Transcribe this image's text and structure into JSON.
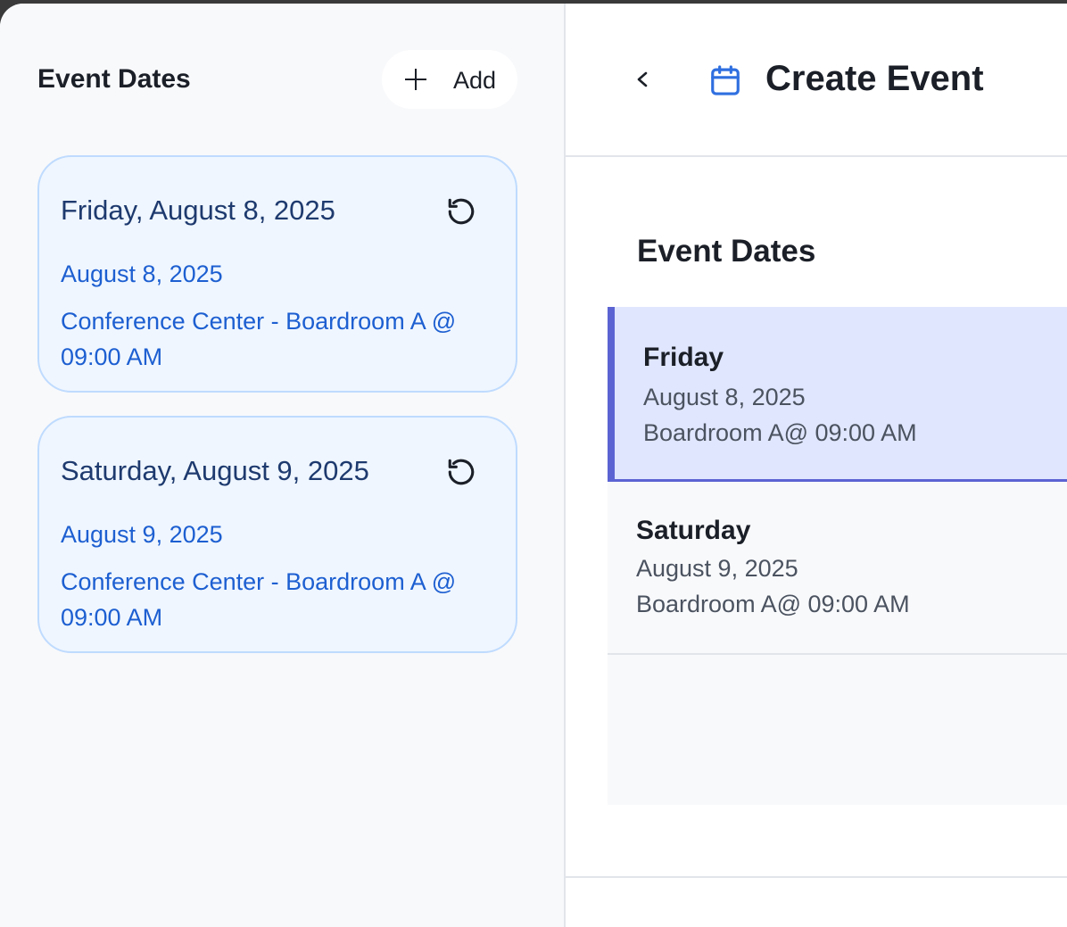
{
  "sidebar": {
    "title": "Event Dates",
    "add_label": "Add",
    "cards": [
      {
        "title": "Friday, August 8, 2025",
        "date": "August 8, 2025",
        "venue": "Conference Center - Boardroom A @ 09:00 AM"
      },
      {
        "title": "Saturday, August 9, 2025",
        "date": "August 9, 2025",
        "venue": "Conference Center - Boardroom A @ 09:00 AM"
      }
    ]
  },
  "header": {
    "title": "Create Event"
  },
  "main": {
    "section_title": "Event Dates",
    "items": [
      {
        "day": "Friday",
        "date": "August 8, 2025",
        "venue": "Boardroom A@ 09:00 AM",
        "selected": true
      },
      {
        "day": "Saturday",
        "date": "August 9, 2025",
        "venue": "Boardroom A@ 09:00 AM",
        "selected": false
      }
    ]
  },
  "colors": {
    "accent": "#5b63d3",
    "card_text": "#1d5fd1",
    "calendar_icon": "#2f6fe0"
  },
  "icons": {
    "add": "plus-icon",
    "reset": "reset-icon",
    "back": "chevron-left-icon",
    "calendar": "calendar-icon"
  }
}
